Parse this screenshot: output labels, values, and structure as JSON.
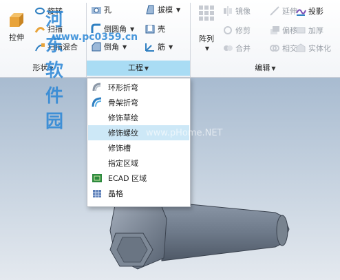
{
  "ribbon": {
    "shape_group": {
      "label": "形状",
      "stretch_label": "拉伸",
      "items": [
        "旋转",
        "扫描",
        "扫描混合"
      ]
    },
    "engineering_group": {
      "label": "工程",
      "col1": [
        "孔",
        "倒圆角",
        "倒角"
      ],
      "col2": [
        "拔模",
        "壳",
        "筋"
      ]
    },
    "edit_group": {
      "label": "编辑",
      "pattern_label": "阵列",
      "col1": [
        "镜像",
        "修剪",
        "合并"
      ],
      "col2": [
        "延伸",
        "偏移",
        "相交"
      ],
      "col3": [
        "投影",
        "加厚",
        "实体化"
      ]
    }
  },
  "dropdown": {
    "items": [
      {
        "label": "环形折弯",
        "icon": "toroidal-bend-icon"
      },
      {
        "label": "骨架折弯",
        "icon": "spinal-bend-icon"
      },
      {
        "label": "修饰草绘",
        "icon": ""
      },
      {
        "label": "修饰螺纹",
        "icon": ""
      },
      {
        "label": "修饰槽",
        "icon": ""
      },
      {
        "label": "指定区域",
        "icon": ""
      },
      {
        "label": "ECAD 区域",
        "icon": "ecad-area-icon"
      },
      {
        "label": "晶格",
        "icon": "lattice-icon"
      }
    ],
    "highlighted_index": 3
  },
  "watermark": {
    "site_name": "河东软件园",
    "url": "www.pc0359.cn",
    "overlay": "www.pHome.NET"
  },
  "colors": {
    "accent": "#a9dcf4",
    "hover": "#cde8f7",
    "watermark": "#2a86d6"
  }
}
